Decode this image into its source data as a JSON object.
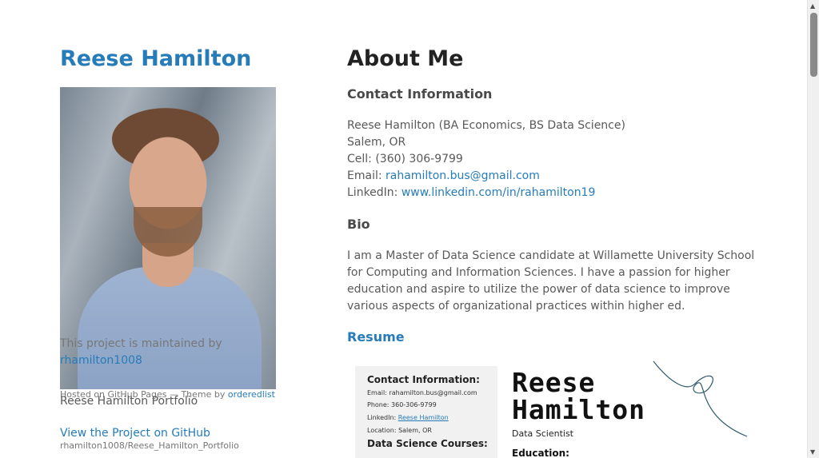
{
  "sidebar": {
    "site_title": "Reese Hamilton",
    "maintained_text": "This project is maintained by",
    "maintainer_link": "rhamilton1008",
    "hosted_prefix": "Hosted on GitHub Pages — Theme by",
    "theme_link": "orderedlist",
    "repo_title": "Reese Hamilton Portfolio",
    "view_project": "View the Project on GitHub",
    "repo_path": "rhamilton1008/Reese_Hamilton_Portfolio"
  },
  "main": {
    "title": "About Me",
    "contact_heading": "Contact Information",
    "contact": {
      "name_line": "Reese Hamilton (BA Economics, BS Data Science)",
      "location": "Salem, OR",
      "cell": "Cell: (360) 306-9799",
      "email_label": "Email: ",
      "email": "rahamilton.bus@gmail.com",
      "linkedin_label": "LinkedIn: ",
      "linkedin": "www.linkedin.com/in/rahamilton19"
    },
    "bio_heading": "Bio",
    "bio_text": "I am a Master of Data Science candidate at Willamette University School for Computing and Information Sciences. I have a passion for higher education and aspire to utilize the power of data science to improve various aspects of organizational practices within higher ed.",
    "resume_link": "Resume"
  },
  "resume_preview": {
    "contact_heading": "Contact Information:",
    "email": "Email: rahamilton.bus@gmail.com",
    "phone": "Phone: 360-306-9799",
    "linkedin_label": "LinkedIn: ",
    "linkedin": "Reese Hamilton",
    "location": "Location: Salem, OR",
    "courses_heading": "Data Science Courses:",
    "name_first": "Reese",
    "name_last": "Hamilton",
    "subtitle": "Data Scientist",
    "education": "Education:"
  },
  "colors": {
    "link": "#267CB9",
    "heading": "#222222",
    "text": "#595959"
  }
}
